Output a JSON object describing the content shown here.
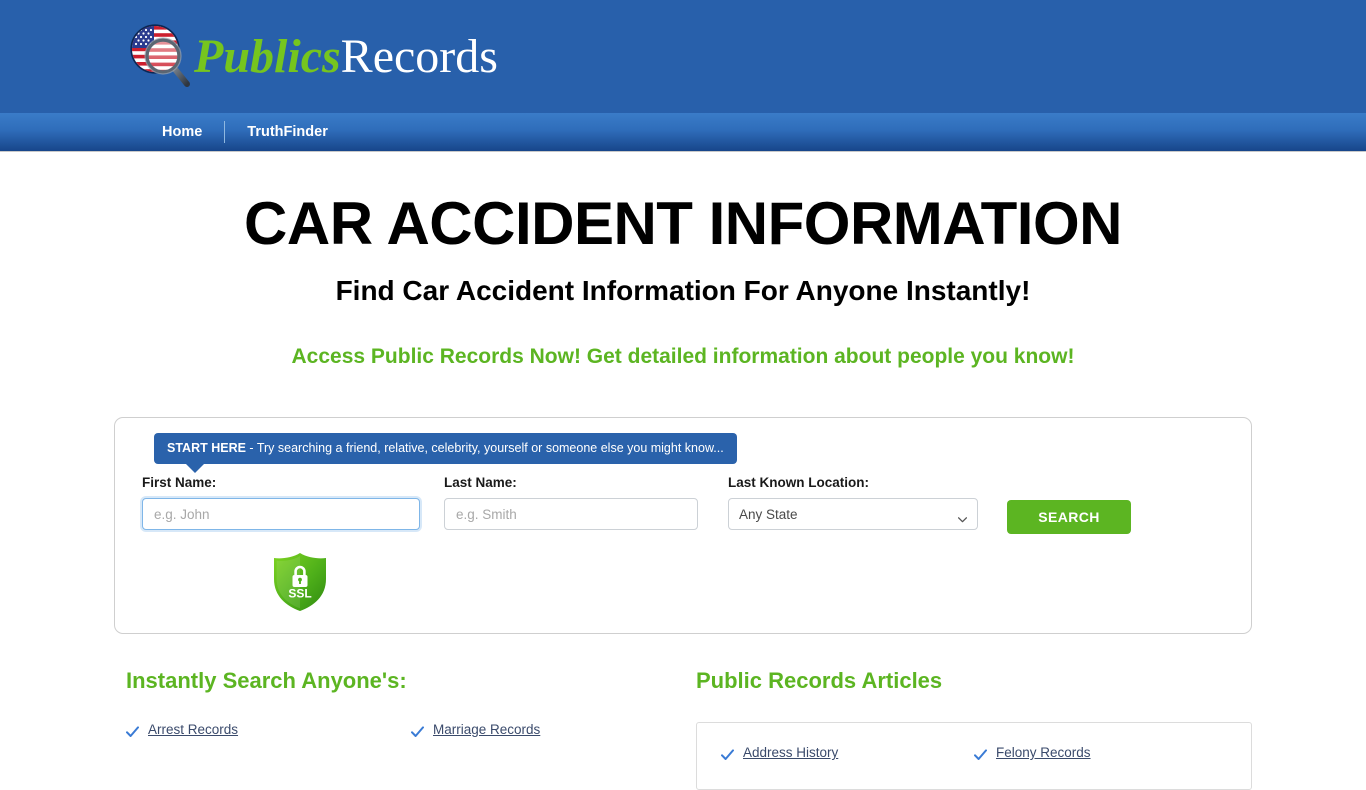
{
  "header": {
    "logo_icon": "us-flag-magnifier-icon",
    "logo_text_accent": "Publics",
    "logo_text_plain": "Records",
    "accent_color": "#76c51e",
    "background_color": "#2860ab"
  },
  "nav": {
    "items": [
      {
        "label": "Home"
      },
      {
        "label": "TruthFinder"
      }
    ]
  },
  "hero": {
    "title": "CAR ACCIDENT INFORMATION",
    "subtitle": "Find Car Accident Information For Anyone Instantly!",
    "tagline": "Access Public Records Now! Get detailed information about people you know!",
    "tagline_color": "#5cb522"
  },
  "search": {
    "start_here_bold": "START HERE",
    "start_here_rest": " - Try searching a friend, relative, celebrity, yourself or someone else you might know...",
    "first_name_label": "First Name:",
    "first_name_value": "",
    "first_name_placeholder": "e.g. John",
    "last_name_label": "Last Name:",
    "last_name_value": "",
    "last_name_placeholder": "e.g. Smith",
    "location_label": "Last Known Location:",
    "location_selected": "Any State",
    "submit_label": "SEARCH",
    "submit_color": "#5cb522",
    "ssl_badge_text": "SSL",
    "ssl_badge_icon": "green-shield-padlock-icon"
  },
  "instantly_search": {
    "title": "Instantly Search Anyone's:",
    "links": [
      {
        "label": "Arrest Records"
      },
      {
        "label": "Marriage Records"
      }
    ]
  },
  "articles": {
    "title": "Public Records Articles",
    "links": [
      {
        "label": "Address History"
      },
      {
        "label": "Felony Records"
      }
    ]
  }
}
